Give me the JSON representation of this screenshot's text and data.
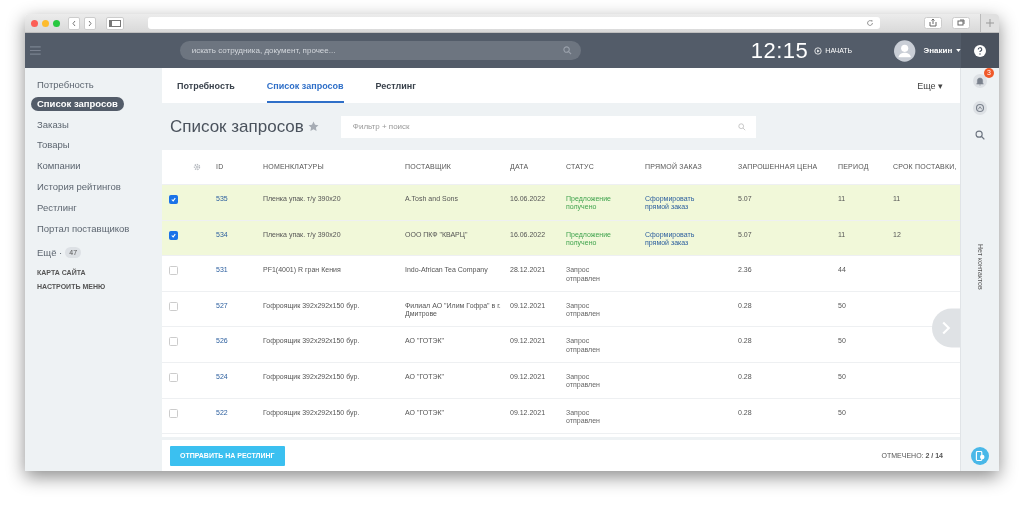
{
  "header": {
    "search": {
      "placeholder": "искать сотрудника, документ, прочее..."
    },
    "time": "12:15",
    "start": "НАЧАТЬ",
    "user": "Энакин"
  },
  "sidebar": {
    "items": [
      {
        "label": "Потребность",
        "selected": false
      },
      {
        "label": "Список запросов",
        "selected": true
      },
      {
        "label": "Заказы",
        "selected": false
      },
      {
        "label": "Товары",
        "selected": false
      },
      {
        "label": "Компании",
        "selected": false
      },
      {
        "label": "История рейтингов",
        "selected": false
      },
      {
        "label": "Рестлинг",
        "selected": false
      },
      {
        "label": "Портал поставщиков",
        "selected": false
      }
    ],
    "more": {
      "label": "Ещё ·",
      "count": "47"
    },
    "links": [
      "КАРТА САЙТА",
      "НАСТРОИТЬ МЕНЮ"
    ]
  },
  "tabs": [
    {
      "label": "Потребность",
      "selected": false
    },
    {
      "label": "Список запросов",
      "selected": true
    },
    {
      "label": "Рестлинг",
      "selected": false
    }
  ],
  "tabs_more": "Еще ▾",
  "title": "Список запросов",
  "filter": {
    "placeholder": "Фильтр + поиск"
  },
  "table": {
    "columns": [
      "ID",
      "НОМЕНКЛАТУРЫ",
      "ПОСТАВЩИК",
      "ДАТА",
      "СТАТУС",
      "ПРЯМОЙ ЗАКАЗ",
      "ЗАПРОШЕННАЯ ЦЕНА",
      "ПЕРИОД",
      "СРОК ПОСТАВКИ,"
    ],
    "rows": [
      {
        "checked": true,
        "id": "535",
        "item": "Пленка упак. т/у 390x20",
        "supplier": "A.Tosh and Sons",
        "date": "16.06.2022",
        "status": {
          "kind": "received",
          "text": "Предложение получено"
        },
        "order": "Сформировать прямой заказ",
        "price": "5.07",
        "period": "11",
        "term": "11"
      },
      {
        "checked": true,
        "id": "534",
        "item": "Пленка упак. т/у 390x20",
        "supplier": "ООО ПКФ \"КВАРЦ\"",
        "date": "16.06.2022",
        "status": {
          "kind": "received",
          "text": "Предложение получено"
        },
        "order": "Сформировать прямой заказ",
        "price": "5.07",
        "period": "11",
        "term": "12"
      },
      {
        "checked": false,
        "id": "531",
        "item": "PF1(4001) R гран Кения",
        "supplier": "Indo-African Tea Company",
        "date": "28.12.2021",
        "status": {
          "kind": "sent",
          "text": "Запрос отправлен"
        },
        "price": "2.36",
        "period": "44"
      },
      {
        "checked": false,
        "id": "527",
        "item": "Гофроящик 392x292x150 бур.",
        "supplier": "Филиал АО \"Илим Гофра\" в г. Дмитрове",
        "date": "09.12.2021",
        "status": {
          "kind": "sent",
          "text": "Запрос отправлен"
        },
        "price": "0.28",
        "period": "50"
      },
      {
        "checked": false,
        "id": "526",
        "item": "Гофроящик 392x292x150 бур.",
        "supplier": "АО \"ГОТЭК\"",
        "date": "09.12.2021",
        "status": {
          "kind": "sent",
          "text": "Запрос отправлен"
        },
        "price": "0.28",
        "period": "50"
      },
      {
        "checked": false,
        "id": "524",
        "item": "Гофроящик 392x292x150 бур.",
        "supplier": "АО \"ГОТЭК\"",
        "date": "09.12.2021",
        "status": {
          "kind": "sent",
          "text": "Запрос отправлен"
        },
        "price": "0.28",
        "period": "50"
      },
      {
        "checked": false,
        "id": "522",
        "item": "Гофроящик 392x292x150 бур.",
        "supplier": "АО \"ГОТЭК\"",
        "date": "09.12.2021",
        "status": {
          "kind": "sent",
          "text": "Запрос отправлен"
        },
        "price": "0.28",
        "period": "50"
      }
    ]
  },
  "footer": {
    "button": "ОТПРАВИТЬ НА РЕСТЛИНГ",
    "marked": "ОТМЕЧЕНО: **2 / 14**"
  },
  "right_panel": {
    "notifications": "3",
    "contacts": "Нет контактов"
  }
}
